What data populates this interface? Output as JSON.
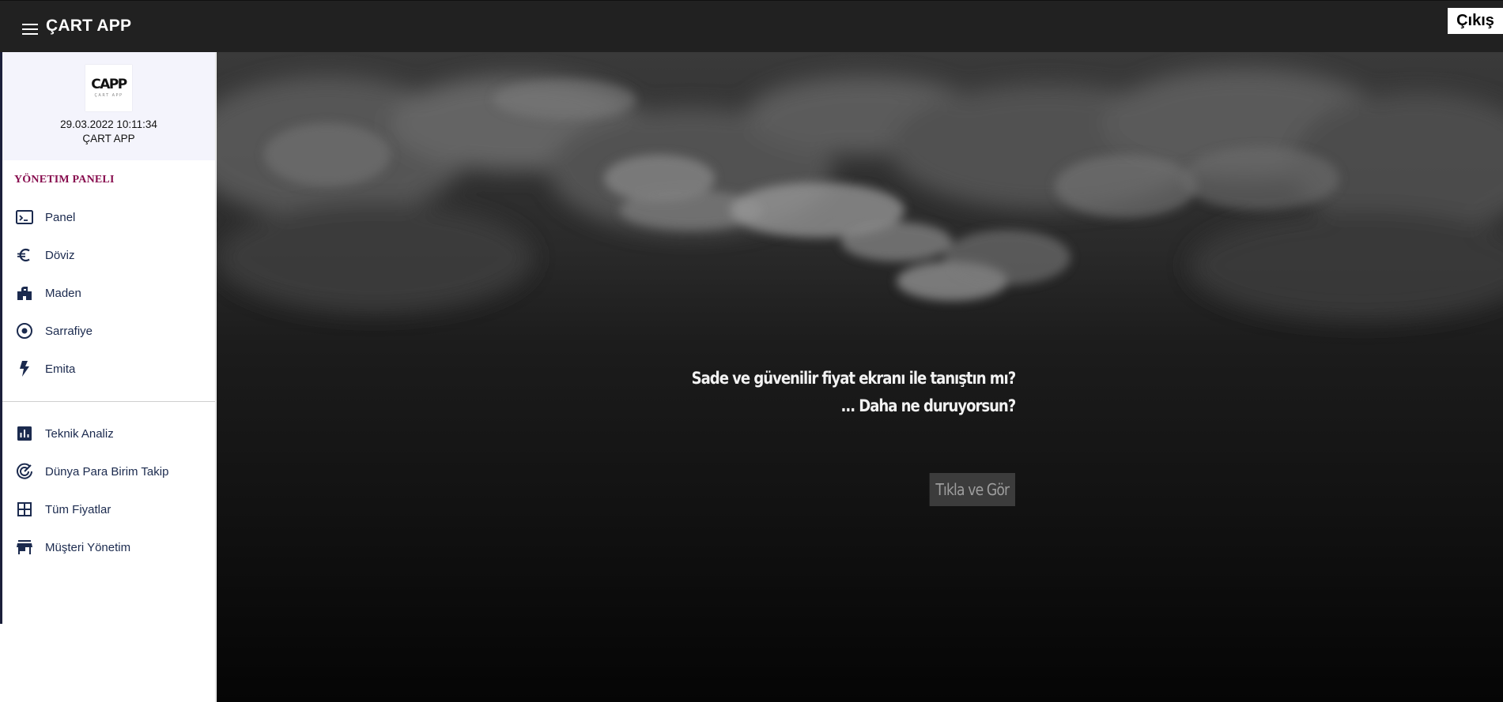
{
  "header": {
    "title": "ÇART APP",
    "logout_label": "Çıkış"
  },
  "profile": {
    "logo_text": "CAPP",
    "logo_subtext": "ÇART APP",
    "datetime": "29.03.2022 10:11:34",
    "name": "ÇART APP"
  },
  "sidebar": {
    "section_title": "YÖNETIM PANELI",
    "items": [
      {
        "label": "Panel",
        "icon": "terminal-icon"
      },
      {
        "label": "Döviz",
        "icon": "euro-icon"
      },
      {
        "label": "Maden",
        "icon": "factory-icon"
      },
      {
        "label": "Sarrafiye",
        "icon": "radio-button-icon"
      },
      {
        "label": "Emita",
        "icon": "bolt-icon"
      }
    ],
    "items2": [
      {
        "label": "Teknik Analiz",
        "icon": "bar-chart-icon"
      },
      {
        "label": "Dünya Para Birim Takip",
        "icon": "track-changes-icon"
      },
      {
        "label": "Tüm Fiyatlar",
        "icon": "grid-icon"
      },
      {
        "label": "Müşteri Yönetim",
        "icon": "store-icon"
      }
    ]
  },
  "hero": {
    "line1": "Sade ve güvenilir fiyat ekranı ile tanıştın mı?",
    "line2": "... Daha ne duruyorsun?",
    "cta_label": "Tıkla ve Gör"
  },
  "colors": {
    "topbar_bg": "#212121",
    "section_title": "#880e4f",
    "nav_text": "#1b2a4e",
    "profile_bg": "#f4f4fc"
  }
}
